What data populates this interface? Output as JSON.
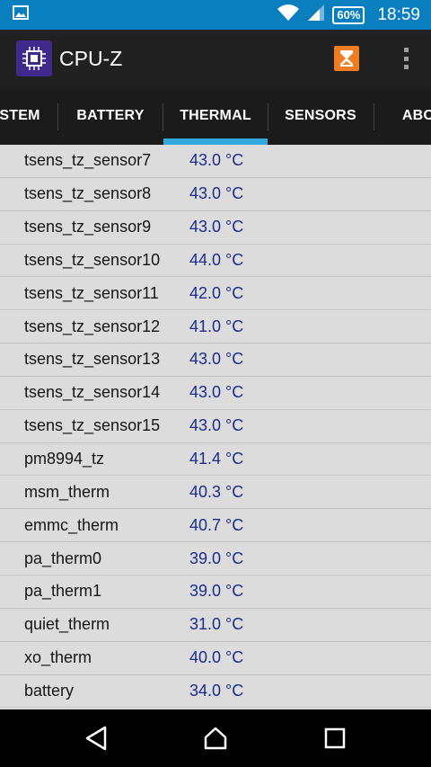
{
  "status_bar": {
    "time": "18:59",
    "battery": "60%",
    "icons": [
      "image-notification-icon",
      "wifi-icon",
      "cell-signal-icon",
      "battery-icon"
    ]
  },
  "app_bar": {
    "title": "CPU-Z",
    "logo_icon": "cpu-chip-icon",
    "action_icon": "hourglass-icon",
    "overflow_icon": "overflow-menu-icon"
  },
  "tabs": {
    "items": [
      {
        "label": "STEM"
      },
      {
        "label": "BATTERY"
      },
      {
        "label": "THERMAL"
      },
      {
        "label": "SENSORS"
      },
      {
        "label": "ABO"
      }
    ],
    "active": "THERMAL",
    "accent_color": "#33a9dc"
  },
  "thermal": {
    "rows": [
      {
        "name": "tsens_tz_sensor7",
        "value": "43.0 °C"
      },
      {
        "name": "tsens_tz_sensor8",
        "value": "43.0 °C"
      },
      {
        "name": "tsens_tz_sensor9",
        "value": "43.0 °C"
      },
      {
        "name": "tsens_tz_sensor10",
        "value": "44.0 °C"
      },
      {
        "name": "tsens_tz_sensor11",
        "value": "42.0 °C"
      },
      {
        "name": "tsens_tz_sensor12",
        "value": "41.0 °C"
      },
      {
        "name": "tsens_tz_sensor13",
        "value": "43.0 °C"
      },
      {
        "name": "tsens_tz_sensor14",
        "value": "43.0 °C"
      },
      {
        "name": "tsens_tz_sensor15",
        "value": "43.0 °C"
      },
      {
        "name": "pm8994_tz",
        "value": "41.4 °C"
      },
      {
        "name": "msm_therm",
        "value": "40.3 °C"
      },
      {
        "name": "emmc_therm",
        "value": "40.7 °C"
      },
      {
        "name": "pa_therm0",
        "value": "39.0 °C"
      },
      {
        "name": "pa_therm1",
        "value": "39.0 °C"
      },
      {
        "name": "quiet_therm",
        "value": "31.0 °C"
      },
      {
        "name": "xo_therm",
        "value": "40.0 °C"
      },
      {
        "name": "battery",
        "value": "34.0 °C"
      }
    ]
  },
  "nav_bar": {
    "buttons": [
      "back-icon",
      "home-icon",
      "recents-icon"
    ]
  }
}
